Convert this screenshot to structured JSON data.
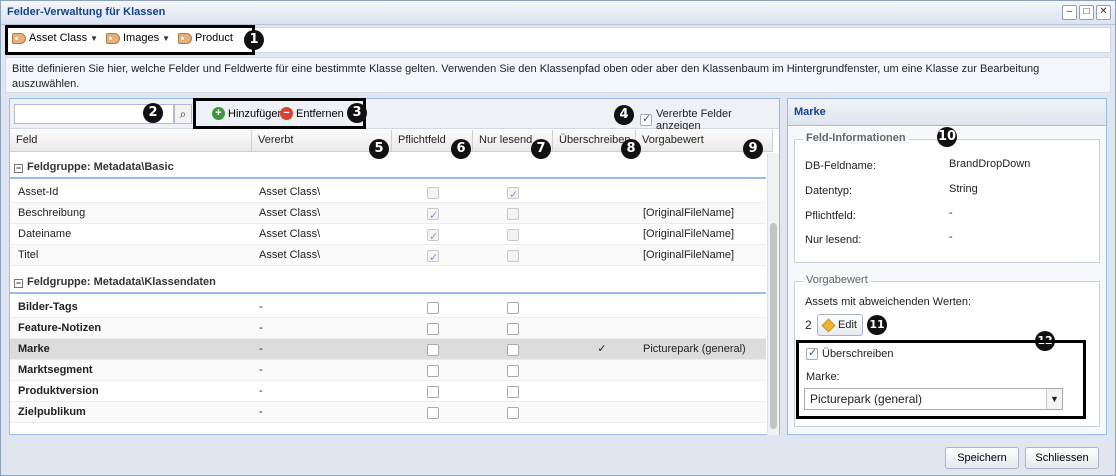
{
  "window": {
    "title": "Felder-Verwaltung für Klassen",
    "tools": [
      "–",
      "□",
      "✕"
    ]
  },
  "breadcrumb": {
    "items": [
      {
        "label": "Asset Class",
        "has_dropdown": true,
        "icon": "tag-icon"
      },
      {
        "label": "Images",
        "has_dropdown": true,
        "icon": "tag-icon"
      },
      {
        "label": "Product",
        "has_dropdown": false,
        "icon": "tag-icon"
      }
    ]
  },
  "info_text": "Bitte definieren Sie hier, welche Felder und Feldwerte für eine bestimmte Klasse gelten. Verwenden Sie den Klassenpfad oben oder aber den Klassenbaum im Hintergrundfenster, um eine Klasse zur Bearbeitung auszuwählen.",
  "grid_toolbar": {
    "search_value": "",
    "add_label": "Hinzufügen",
    "remove_label": "Entfernen",
    "show_inherited_label": "Vererbte Felder anzeigen",
    "show_inherited_checked": true
  },
  "columns": [
    "Feld",
    "Vererbt",
    "Pflichtfeld",
    "Nur lesend",
    "Überschreiben",
    "Vorgabewert"
  ],
  "groups": [
    {
      "label": "Feldgruppe: Metadata\\Basic",
      "rows": [
        {
          "feld": "Asset-Id",
          "vererbt": "Asset Class\\",
          "pflicht": false,
          "nur": true,
          "ueber": "",
          "vorgabe": "",
          "bold": false,
          "selected": false
        },
        {
          "feld": "Beschreibung",
          "vererbt": "Asset Class\\",
          "pflicht": true,
          "nur": false,
          "ueber": "",
          "vorgabe": "[OriginalFileName]",
          "bold": false,
          "selected": false
        },
        {
          "feld": "Dateiname",
          "vererbt": "Asset Class\\",
          "pflicht": true,
          "nur": false,
          "ueber": "",
          "vorgabe": "[OriginalFileName]",
          "bold": false,
          "selected": false
        },
        {
          "feld": "Titel",
          "vererbt": "Asset Class\\",
          "pflicht": true,
          "nur": false,
          "ueber": "",
          "vorgabe": "[OriginalFileName]",
          "bold": false,
          "selected": false
        }
      ]
    },
    {
      "label": "Feldgruppe: Metadata\\Klassendaten",
      "rows": [
        {
          "feld": "Bilder-Tags",
          "vererbt": "-",
          "pflicht": false,
          "nur": false,
          "ueber": "",
          "vorgabe": "",
          "bold": true,
          "selected": false
        },
        {
          "feld": "Feature-Notizen",
          "vererbt": "-",
          "pflicht": false,
          "nur": false,
          "ueber": "",
          "vorgabe": "",
          "bold": true,
          "selected": false
        },
        {
          "feld": "Marke",
          "vererbt": "-",
          "pflicht": false,
          "nur": false,
          "ueber": "✓",
          "vorgabe": "Picturepark (general)",
          "bold": true,
          "selected": true
        },
        {
          "feld": "Marktsegment",
          "vererbt": "-",
          "pflicht": false,
          "nur": false,
          "ueber": "",
          "vorgabe": "",
          "bold": true,
          "selected": false
        },
        {
          "feld": "Produktversion",
          "vererbt": "-",
          "pflicht": false,
          "nur": false,
          "ueber": "",
          "vorgabe": "",
          "bold": true,
          "selected": false
        },
        {
          "feld": "Zielpublikum",
          "vererbt": "-",
          "pflicht": false,
          "nur": false,
          "ueber": "",
          "vorgabe": "",
          "bold": true,
          "selected": false
        }
      ]
    }
  ],
  "detail": {
    "title": "Marke",
    "field_info_legend": "Feld-Informationen",
    "labels": {
      "db_feldname": "DB-Feldname:",
      "datentyp": "Datentyp:",
      "pflichtfeld": "Pflichtfeld:",
      "nur_lesend": "Nur lesend:"
    },
    "values": {
      "db_feldname": "BrandDropDown",
      "datentyp": "String",
      "pflichtfeld": "-",
      "nur_lesend": "-"
    },
    "default_legend": "Vorgabewert",
    "assets_label": "Assets mit abweichenden Werten:",
    "assets_count": "2",
    "edit_label": "Edit",
    "override_label": "Überschreiben",
    "override_checked": true,
    "marke_label": "Marke:",
    "marke_value": "Picturepark (general)"
  },
  "footer": {
    "save_label": "Speichern",
    "close_label": "Schliessen"
  },
  "badges": [
    "1",
    "2",
    "3",
    "4",
    "5",
    "6",
    "7",
    "8",
    "9",
    "10",
    "11",
    "12"
  ]
}
